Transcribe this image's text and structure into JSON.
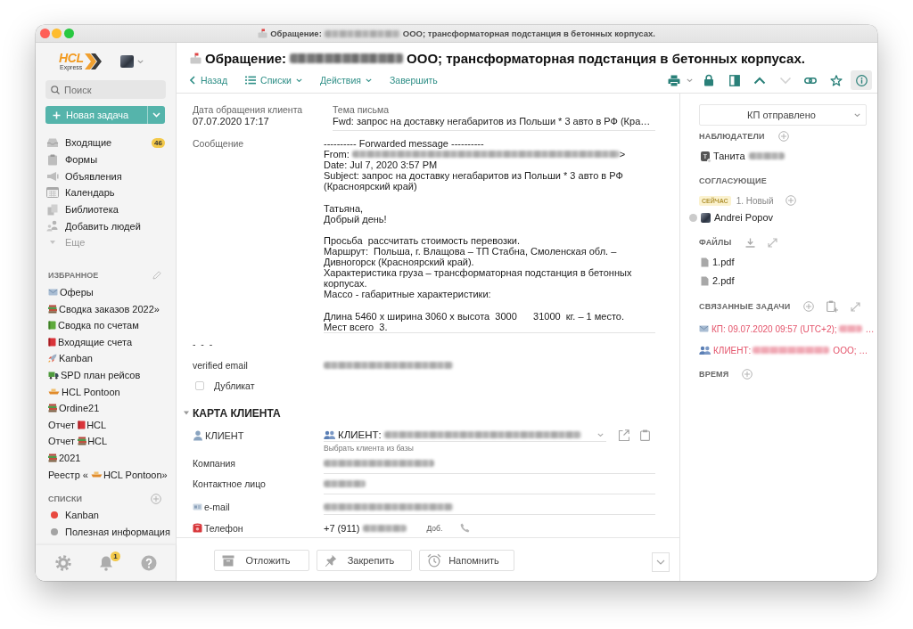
{
  "window": {
    "title_prefix": "Обращение:",
    "title_suffix": "ООО; трансформаторная подстанция в бетонных корпусах."
  },
  "sidebar": {
    "logo": {
      "name": "HCL",
      "subtitle": "Express"
    },
    "search": {
      "placeholder": "Поиск"
    },
    "new_task": "Новая задача",
    "nav": [
      {
        "label": "Входящие",
        "badge": "46"
      },
      {
        "label": "Формы"
      },
      {
        "label": "Объявления"
      },
      {
        "label": "Календарь"
      },
      {
        "label": "Библиотека"
      },
      {
        "label": "Добавить людей"
      }
    ],
    "more": "Еще",
    "favorites": {
      "title": "ИЗБРАННОЕ",
      "items": [
        {
          "label": "Оферы"
        },
        {
          "label": "Сводка заказов 2022»"
        },
        {
          "label": "Сводка по счетам"
        },
        {
          "label": "Входящие счета"
        },
        {
          "label": "Kanban"
        },
        {
          "label": "SPD план рейсов"
        },
        {
          "label": "HCL Pontoon"
        },
        {
          "label": "Ordine21"
        },
        {
          "prefix": "Отчет",
          "label": "HCL"
        },
        {
          "prefix": "Отчет",
          "label": "HCL"
        },
        {
          "label": "2021"
        },
        {
          "prefix": "Реестр «",
          "label": "HCL Pontoon»"
        }
      ]
    },
    "lists": {
      "title": "СПИСКИ",
      "items": [
        {
          "label": "Kanban",
          "color": "#e8483f"
        },
        {
          "label": "Полезная информация",
          "color": "#a3a3a3"
        }
      ]
    },
    "notifications": "1"
  },
  "header": {
    "title_prefix": "Обращение:",
    "title_suffix": "ООО; трансформаторная подстанция в бетонных корпусах."
  },
  "toolbar": {
    "back": "Назад",
    "lists": "Списки",
    "actions": "Действия",
    "finish": "Завершить",
    "icons": [
      {
        "disabled": false,
        "selected": false
      },
      {
        "disabled": false,
        "selected": false
      },
      {
        "disabled": false,
        "selected": false
      },
      {
        "disabled": false,
        "selected": false
      },
      {
        "disabled": true,
        "selected": false
      },
      {
        "disabled": false,
        "selected": false
      },
      {
        "disabled": false,
        "selected": false
      },
      {
        "disabled": false,
        "selected": true
      }
    ]
  },
  "form": {
    "date": {
      "label": "Дата обращения клиента",
      "value": "07.07.2020 17:17"
    },
    "subject": {
      "label": "Тема письма",
      "value": "Fwd: запрос на доставку негабаритов из Польши * 3 авто в РФ (Кра…"
    },
    "message": {
      "label": "Сообщение",
      "forwarded": "---------- Forwarded message ----------",
      "from_label": "From:",
      "from_end": ">",
      "date": "Date: Jul 7, 2020 3:57 PM",
      "subject": "Subject: запрос на доставку негабаритов из Польши * 3 авто в РФ (Красноярский край)",
      "paragraphs": [
        "Татьяна,\nДобрый день!",
        "Просьба  рассчитать стоимость перевозки.\nМаршрут:  Польша, г. Влащова – ТП Стабна, Смоленская обл. – Дивногорск (Красноярский край).\nХарактеристика груза – трансформаторная подстанция в бетонных корпусах.\nМассо - габаритные характеристики:",
        "Длина 5460 х ширина 3060 х высота  3000      31000  кг. – 1 место.\nМест всего  3."
      ]
    },
    "divider_label": "-  -  -",
    "verified_email": {
      "label": "verified email"
    },
    "duplicate": {
      "label": "Дубликат",
      "checked": false
    },
    "client_card": {
      "title": "КАРТА КЛИЕНТА",
      "expanded": true,
      "client": {
        "label": "КЛИЕНТ",
        "value": "КЛИЕНТ:",
        "hint": "Выбрать клиента из базы"
      },
      "company": {
        "label": "Компания"
      },
      "contact": {
        "label": "Контактное лицо"
      },
      "email": {
        "label": "e-mail"
      },
      "phone": {
        "label": "Телефон",
        "value": "+7 (911)",
        "extension": "Доб."
      }
    }
  },
  "footer": {
    "buttons": [
      "Отложить",
      "Закрепить",
      "Напомнить"
    ]
  },
  "side_panel": {
    "status": "КП отправлено",
    "watchers": {
      "title": "НАБЛЮДАТЕЛИ",
      "people": [
        {
          "initial": "Т",
          "name": "Танита"
        }
      ]
    },
    "approvers": {
      "title": "СОГЛАСУЮЩИЕ",
      "badge": "СЕЙЧАС",
      "stage": "1. Новый",
      "people": [
        {
          "name": "Andrei Popov"
        }
      ]
    },
    "files": {
      "title": "ФАЙЛЫ",
      "items": [
        "1.pdf",
        "2.pdf"
      ]
    },
    "related": {
      "title": "СВЯЗАННЫЕ ЗАДАЧИ",
      "items": [
        {
          "text": "КП: 09.07.2020 09:57 (UTC+2);",
          "end": "…"
        },
        {
          "text": "КЛИЕНТ:",
          "end": "ООО; …"
        }
      ]
    },
    "time": {
      "title": "ВРЕМЯ"
    }
  }
}
